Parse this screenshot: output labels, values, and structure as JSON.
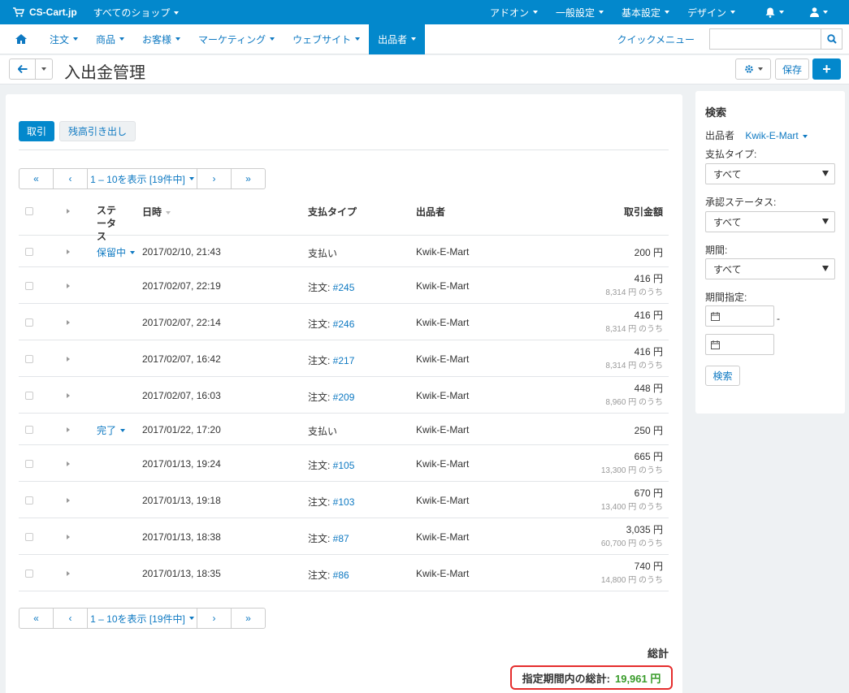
{
  "topbar": {
    "brand": "CS-Cart.jp",
    "shops": "すべてのショップ",
    "items": [
      "アドオン",
      "一般設定",
      "基本設定",
      "デザイン"
    ]
  },
  "nav": {
    "tabs": [
      "注文",
      "商品",
      "お客様",
      "マーケティング",
      "ウェブサイト",
      "出品者"
    ],
    "quick_menu": "クイックメニュー",
    "search_placeholder": ""
  },
  "page": {
    "title": "入出金管理",
    "save": "保存"
  },
  "subtabs": [
    "取引",
    "残高引き出し"
  ],
  "pagination": {
    "first": "«",
    "prev": "‹",
    "range": "1 – 10を表示 [19件中]",
    "next": "›",
    "last": "»"
  },
  "table": {
    "headers": {
      "status": "ステータス",
      "date": "日時",
      "type": "支払タイプ",
      "vendor": "出品者",
      "amount": "取引金額"
    },
    "rows": [
      {
        "status": "保留中",
        "date": "2017/02/10, 21:43",
        "type_label": "支払い",
        "order": "",
        "vendor": "Kwik-E-Mart",
        "amount": "200 円",
        "sub": ""
      },
      {
        "status": "",
        "date": "2017/02/07, 22:19",
        "type_label": "注文: ",
        "order": "#245",
        "vendor": "Kwik-E-Mart",
        "amount": "416 円",
        "sub": "8,314 円 のうち"
      },
      {
        "status": "",
        "date": "2017/02/07, 22:14",
        "type_label": "注文: ",
        "order": "#246",
        "vendor": "Kwik-E-Mart",
        "amount": "416 円",
        "sub": "8,314 円 のうち"
      },
      {
        "status": "",
        "date": "2017/02/07, 16:42",
        "type_label": "注文: ",
        "order": "#217",
        "vendor": "Kwik-E-Mart",
        "amount": "416 円",
        "sub": "8,314 円 のうち"
      },
      {
        "status": "",
        "date": "2017/02/07, 16:03",
        "type_label": "注文: ",
        "order": "#209",
        "vendor": "Kwik-E-Mart",
        "amount": "448 円",
        "sub": "8,960 円 のうち"
      },
      {
        "status": "完了",
        "date": "2017/01/22, 17:20",
        "type_label": "支払い",
        "order": "",
        "vendor": "Kwik-E-Mart",
        "amount": "250 円",
        "sub": ""
      },
      {
        "status": "",
        "date": "2017/01/13, 19:24",
        "type_label": "注文: ",
        "order": "#105",
        "vendor": "Kwik-E-Mart",
        "amount": "665 円",
        "sub": "13,300 円 のうち"
      },
      {
        "status": "",
        "date": "2017/01/13, 19:18",
        "type_label": "注文: ",
        "order": "#103",
        "vendor": "Kwik-E-Mart",
        "amount": "670 円",
        "sub": "13,400 円 のうち"
      },
      {
        "status": "",
        "date": "2017/01/13, 18:38",
        "type_label": "注文: ",
        "order": "#87",
        "vendor": "Kwik-E-Mart",
        "amount": "3,035 円",
        "sub": "60,700 円 のうち"
      },
      {
        "status": "",
        "date": "2017/01/13, 18:35",
        "type_label": "注文: ",
        "order": "#86",
        "vendor": "Kwik-E-Mart",
        "amount": "740 円",
        "sub": "14,800 円 のうち"
      }
    ]
  },
  "totals": {
    "heading": "総計",
    "period_label": "指定期間内の総計:",
    "period_value": "19,961 円"
  },
  "sidebar": {
    "title": "検索",
    "vendor_label": "出品者",
    "vendor_value": "Kwik-E-Mart",
    "payment_type_label": "支払タイプ:",
    "payment_type_value": "すべて",
    "approval_label": "承認ステータス:",
    "approval_value": "すべて",
    "period_label": "期間:",
    "period_value": "すべて",
    "range_label": "期間指定:",
    "range_sep": "-",
    "search_button": "検索"
  },
  "colors": {
    "primary": "#0388cc",
    "link": "#0e79c2",
    "total_green": "#3a9c2b",
    "highlight_red": "#e52d2d"
  }
}
